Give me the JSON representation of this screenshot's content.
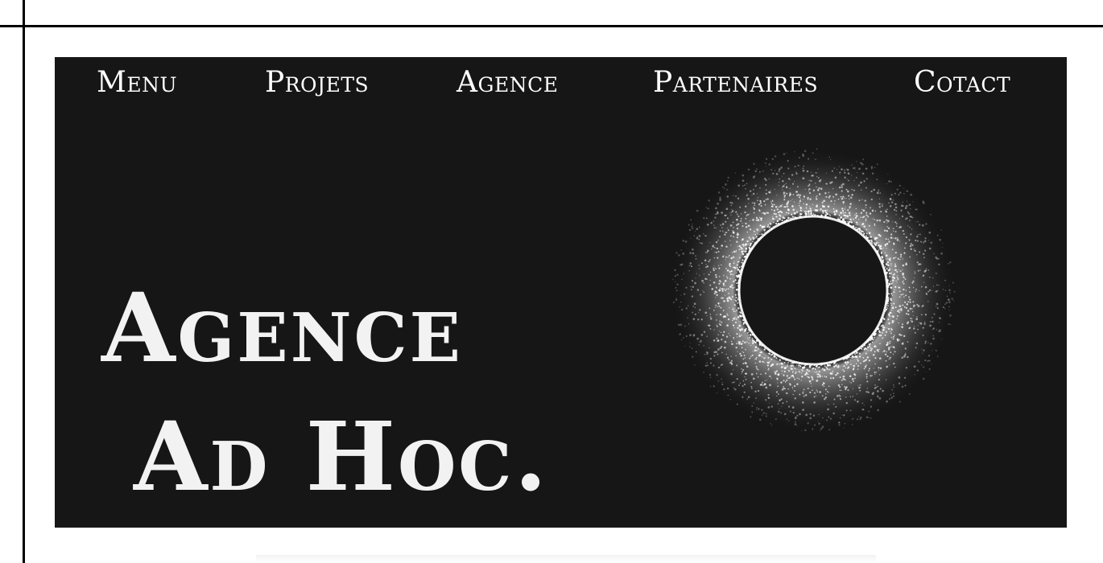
{
  "nav": {
    "items": [
      {
        "label": "Menu"
      },
      {
        "label": "Projets"
      },
      {
        "label": "Agence"
      },
      {
        "label": "Partenaires"
      },
      {
        "label": "Cotact"
      }
    ]
  },
  "hero": {
    "title_line1": "Agence",
    "title_line2": "Ad Hoc.",
    "graphic": "particle-ring-icon"
  },
  "colors": {
    "background": "#ffffff",
    "hero_background": "#161616",
    "text": "#f2f2f2",
    "frame_lines": "#000000"
  }
}
